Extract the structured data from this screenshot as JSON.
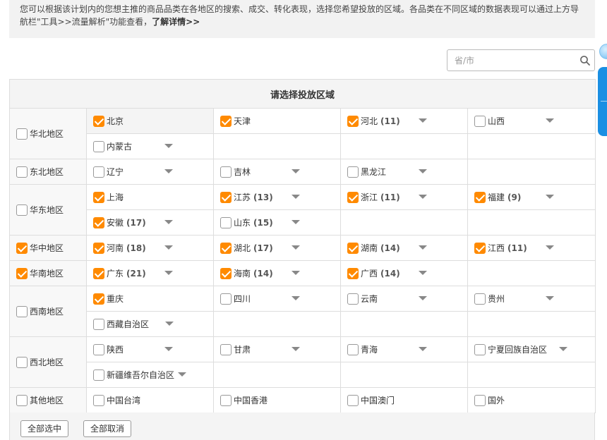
{
  "notice": {
    "text": "您可以根据该计划内的您想主推的商品品类在各地区的搜索、成交、转化表现，选择您希望投放的区域。各品类在不同区域的数据表现可以通过上方导航栏\"工具>>流量解析\"功能查看，",
    "link": "了解详情>>"
  },
  "search": {
    "placeholder": "省/市",
    "value": ""
  },
  "table": {
    "header": "请选择投放区域"
  },
  "regions": [
    {
      "name": "华北地区",
      "checked": false,
      "rows": [
        [
          {
            "name": "北京",
            "count": "",
            "checked": true,
            "selected": true,
            "dropdown": false
          },
          {
            "name": "天津",
            "count": "",
            "checked": true,
            "dropdown": false
          },
          {
            "name": "河北",
            "count": "(11)",
            "checked": true,
            "dropdown": true
          },
          {
            "name": "山西",
            "count": "",
            "checked": false,
            "dropdown": true
          }
        ],
        [
          {
            "name": "内蒙古",
            "count": "",
            "checked": false,
            "dropdown": true
          }
        ]
      ]
    },
    {
      "name": "东北地区",
      "checked": false,
      "rows": [
        [
          {
            "name": "辽宁",
            "count": "",
            "checked": false,
            "dropdown": true
          },
          {
            "name": "吉林",
            "count": "",
            "checked": false,
            "dropdown": true
          },
          {
            "name": "黑龙江",
            "count": "",
            "checked": false,
            "dropdown": true
          }
        ]
      ]
    },
    {
      "name": "华东地区",
      "checked": false,
      "rows": [
        [
          {
            "name": "上海",
            "count": "",
            "checked": true,
            "dropdown": false
          },
          {
            "name": "江苏",
            "count": "(13)",
            "checked": true,
            "dropdown": true
          },
          {
            "name": "浙江",
            "count": "(11)",
            "checked": true,
            "dropdown": true
          },
          {
            "name": "福建",
            "count": "(9)",
            "checked": true,
            "dropdown": true
          }
        ],
        [
          {
            "name": "安徽",
            "count": "(17)",
            "checked": true,
            "dropdown": true
          },
          {
            "name": "山东",
            "count": "(15)",
            "checked": false,
            "dropdown": true
          }
        ]
      ]
    },
    {
      "name": "华中地区",
      "checked": true,
      "rows": [
        [
          {
            "name": "河南",
            "count": "(18)",
            "checked": true,
            "dropdown": true
          },
          {
            "name": "湖北",
            "count": "(17)",
            "checked": true,
            "dropdown": true
          },
          {
            "name": "湖南",
            "count": "(14)",
            "checked": true,
            "dropdown": true
          },
          {
            "name": "江西",
            "count": "(11)",
            "checked": true,
            "dropdown": true
          }
        ]
      ]
    },
    {
      "name": "华南地区",
      "checked": true,
      "rows": [
        [
          {
            "name": "广东",
            "count": "(21)",
            "checked": true,
            "dropdown": true
          },
          {
            "name": "海南",
            "count": "(14)",
            "checked": true,
            "dropdown": true
          },
          {
            "name": "广西",
            "count": "(14)",
            "checked": true,
            "dropdown": true
          }
        ]
      ]
    },
    {
      "name": "西南地区",
      "checked": false,
      "rows": [
        [
          {
            "name": "重庆",
            "count": "",
            "checked": true,
            "dropdown": false
          },
          {
            "name": "四川",
            "count": "",
            "checked": false,
            "dropdown": true
          },
          {
            "name": "云南",
            "count": "",
            "checked": false,
            "dropdown": true
          },
          {
            "name": "贵州",
            "count": "",
            "checked": false,
            "dropdown": true
          }
        ],
        [
          {
            "name": "西藏自治区",
            "count": "",
            "checked": false,
            "dropdown": true
          }
        ]
      ]
    },
    {
      "name": "西北地区",
      "checked": false,
      "rows": [
        [
          {
            "name": "陕西",
            "count": "",
            "checked": false,
            "dropdown": true
          },
          {
            "name": "甘肃",
            "count": "",
            "checked": false,
            "dropdown": true
          },
          {
            "name": "青海",
            "count": "",
            "checked": false,
            "dropdown": true
          },
          {
            "name": "宁夏回族自治区",
            "count": "",
            "checked": false,
            "dropdown": true
          }
        ],
        [
          {
            "name": "新疆维吾尔自治区",
            "count": "",
            "checked": false,
            "dropdown": true
          }
        ]
      ]
    },
    {
      "name": "其他地区",
      "checked": false,
      "rows": [
        [
          {
            "name": "中国台湾",
            "count": "",
            "checked": false,
            "dropdown": false
          },
          {
            "name": "中国香港",
            "count": "",
            "checked": false,
            "dropdown": false
          },
          {
            "name": "中国澳门",
            "count": "",
            "checked": false,
            "dropdown": false
          },
          {
            "name": "国外",
            "count": "",
            "checked": false,
            "dropdown": false
          }
        ]
      ]
    }
  ],
  "footer": {
    "select_all": "全部选中",
    "deselect_all": "全部取消"
  },
  "colors": {
    "accent": "#ff8a00",
    "side_widget": "#1a8fe3"
  }
}
